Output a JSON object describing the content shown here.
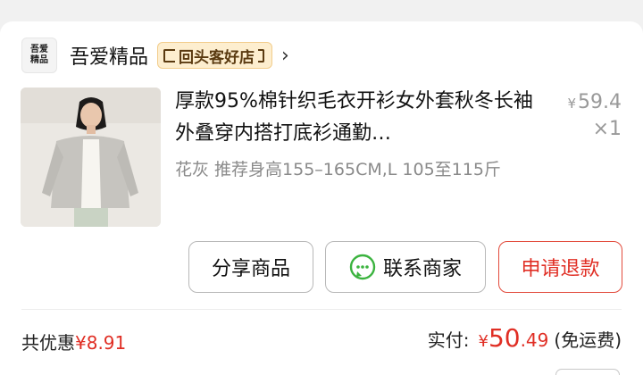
{
  "shop": {
    "logo_line1": "吾爱",
    "logo_line2": "精品",
    "name": "吾爱精品",
    "badge": "回头客好店"
  },
  "product": {
    "title": "厚款95%棉针织毛衣开衫女外套秋冬长袖外叠穿内搭打底衫通勤…",
    "price_symbol": "¥",
    "price": "59.4",
    "quantity": "×1",
    "sku": "花灰  推荐身高155–165CM,L  105至115斤"
  },
  "actions": {
    "share": "分享商品",
    "contact": "联系商家",
    "refund": "申请退款"
  },
  "summary": {
    "discount_label": "共优惠",
    "discount_amount": "¥8.91",
    "paid_label": "实付:",
    "paid_symbol": "¥",
    "paid_integer": "50",
    "paid_decimal": ".49",
    "shipping": "(免运费)"
  },
  "colors": {
    "accent_red": "#e02e24",
    "badge_bg": "#fdeecf",
    "wechat_green": "#3bb33f"
  },
  "icons": {
    "shop_chevron": "chevron-right-icon",
    "contact": "chat-bubble-icon"
  }
}
